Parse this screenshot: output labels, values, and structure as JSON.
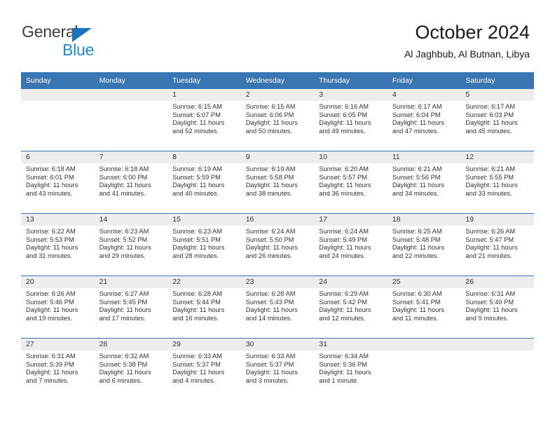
{
  "brand": {
    "name_part1": "General",
    "name_part2": "Blue",
    "triangle_color": "#1574bd",
    "blue_color": "#1e8ad6"
  },
  "header": {
    "title": "October 2024",
    "subtitle": "Al Jaghbub, Al Butnan, Libya"
  },
  "theme": {
    "header_blue": "#3b76b4",
    "daynum_band": "#ededed",
    "text": "#333333"
  },
  "weekdays": [
    "Sunday",
    "Monday",
    "Tuesday",
    "Wednesday",
    "Thursday",
    "Friday",
    "Saturday"
  ],
  "weeks": [
    [
      {
        "day": "",
        "sunrise": "",
        "sunset": "",
        "daylight_l1": "",
        "daylight_l2": ""
      },
      {
        "day": "",
        "sunrise": "",
        "sunset": "",
        "daylight_l1": "",
        "daylight_l2": ""
      },
      {
        "day": "1",
        "sunrise": "Sunrise: 6:15 AM",
        "sunset": "Sunset: 6:07 PM",
        "daylight_l1": "Daylight: 11 hours",
        "daylight_l2": "and 52 minutes."
      },
      {
        "day": "2",
        "sunrise": "Sunrise: 6:15 AM",
        "sunset": "Sunset: 6:06 PM",
        "daylight_l1": "Daylight: 11 hours",
        "daylight_l2": "and 50 minutes."
      },
      {
        "day": "3",
        "sunrise": "Sunrise: 6:16 AM",
        "sunset": "Sunset: 6:05 PM",
        "daylight_l1": "Daylight: 11 hours",
        "daylight_l2": "and 49 minutes."
      },
      {
        "day": "4",
        "sunrise": "Sunrise: 6:17 AM",
        "sunset": "Sunset: 6:04 PM",
        "daylight_l1": "Daylight: 11 hours",
        "daylight_l2": "and 47 minutes."
      },
      {
        "day": "5",
        "sunrise": "Sunrise: 6:17 AM",
        "sunset": "Sunset: 6:03 PM",
        "daylight_l1": "Daylight: 11 hours",
        "daylight_l2": "and 45 minutes."
      }
    ],
    [
      {
        "day": "6",
        "sunrise": "Sunrise: 6:18 AM",
        "sunset": "Sunset: 6:01 PM",
        "daylight_l1": "Daylight: 11 hours",
        "daylight_l2": "and 43 minutes."
      },
      {
        "day": "7",
        "sunrise": "Sunrise: 6:18 AM",
        "sunset": "Sunset: 6:00 PM",
        "daylight_l1": "Daylight: 11 hours",
        "daylight_l2": "and 41 minutes."
      },
      {
        "day": "8",
        "sunrise": "Sunrise: 6:19 AM",
        "sunset": "Sunset: 5:59 PM",
        "daylight_l1": "Daylight: 11 hours",
        "daylight_l2": "and 40 minutes."
      },
      {
        "day": "9",
        "sunrise": "Sunrise: 6:19 AM",
        "sunset": "Sunset: 5:58 PM",
        "daylight_l1": "Daylight: 11 hours",
        "daylight_l2": "and 38 minutes."
      },
      {
        "day": "10",
        "sunrise": "Sunrise: 6:20 AM",
        "sunset": "Sunset: 5:57 PM",
        "daylight_l1": "Daylight: 11 hours",
        "daylight_l2": "and 36 minutes."
      },
      {
        "day": "11",
        "sunrise": "Sunrise: 6:21 AM",
        "sunset": "Sunset: 5:56 PM",
        "daylight_l1": "Daylight: 11 hours",
        "daylight_l2": "and 34 minutes."
      },
      {
        "day": "12",
        "sunrise": "Sunrise: 6:21 AM",
        "sunset": "Sunset: 5:55 PM",
        "daylight_l1": "Daylight: 11 hours",
        "daylight_l2": "and 33 minutes."
      }
    ],
    [
      {
        "day": "13",
        "sunrise": "Sunrise: 6:22 AM",
        "sunset": "Sunset: 5:53 PM",
        "daylight_l1": "Daylight: 11 hours",
        "daylight_l2": "and 31 minutes."
      },
      {
        "day": "14",
        "sunrise": "Sunrise: 6:23 AM",
        "sunset": "Sunset: 5:52 PM",
        "daylight_l1": "Daylight: 11 hours",
        "daylight_l2": "and 29 minutes."
      },
      {
        "day": "15",
        "sunrise": "Sunrise: 6:23 AM",
        "sunset": "Sunset: 5:51 PM",
        "daylight_l1": "Daylight: 11 hours",
        "daylight_l2": "and 28 minutes."
      },
      {
        "day": "16",
        "sunrise": "Sunrise: 6:24 AM",
        "sunset": "Sunset: 5:50 PM",
        "daylight_l1": "Daylight: 11 hours",
        "daylight_l2": "and 26 minutes."
      },
      {
        "day": "17",
        "sunrise": "Sunrise: 6:24 AM",
        "sunset": "Sunset: 5:49 PM",
        "daylight_l1": "Daylight: 11 hours",
        "daylight_l2": "and 24 minutes."
      },
      {
        "day": "18",
        "sunrise": "Sunrise: 6:25 AM",
        "sunset": "Sunset: 5:48 PM",
        "daylight_l1": "Daylight: 11 hours",
        "daylight_l2": "and 22 minutes."
      },
      {
        "day": "19",
        "sunrise": "Sunrise: 6:26 AM",
        "sunset": "Sunset: 5:47 PM",
        "daylight_l1": "Daylight: 11 hours",
        "daylight_l2": "and 21 minutes."
      }
    ],
    [
      {
        "day": "20",
        "sunrise": "Sunrise: 6:26 AM",
        "sunset": "Sunset: 5:46 PM",
        "daylight_l1": "Daylight: 11 hours",
        "daylight_l2": "and 19 minutes."
      },
      {
        "day": "21",
        "sunrise": "Sunrise: 6:27 AM",
        "sunset": "Sunset: 5:45 PM",
        "daylight_l1": "Daylight: 11 hours",
        "daylight_l2": "and 17 minutes."
      },
      {
        "day": "22",
        "sunrise": "Sunrise: 6:28 AM",
        "sunset": "Sunset: 5:44 PM",
        "daylight_l1": "Daylight: 11 hours",
        "daylight_l2": "and 16 minutes."
      },
      {
        "day": "23",
        "sunrise": "Sunrise: 6:28 AM",
        "sunset": "Sunset: 5:43 PM",
        "daylight_l1": "Daylight: 11 hours",
        "daylight_l2": "and 14 minutes."
      },
      {
        "day": "24",
        "sunrise": "Sunrise: 6:29 AM",
        "sunset": "Sunset: 5:42 PM",
        "daylight_l1": "Daylight: 11 hours",
        "daylight_l2": "and 12 minutes."
      },
      {
        "day": "25",
        "sunrise": "Sunrise: 6:30 AM",
        "sunset": "Sunset: 5:41 PM",
        "daylight_l1": "Daylight: 11 hours",
        "daylight_l2": "and 11 minutes."
      },
      {
        "day": "26",
        "sunrise": "Sunrise: 6:31 AM",
        "sunset": "Sunset: 5:40 PM",
        "daylight_l1": "Daylight: 11 hours",
        "daylight_l2": "and 9 minutes."
      }
    ],
    [
      {
        "day": "27",
        "sunrise": "Sunrise: 6:31 AM",
        "sunset": "Sunset: 5:39 PM",
        "daylight_l1": "Daylight: 11 hours",
        "daylight_l2": "and 7 minutes."
      },
      {
        "day": "28",
        "sunrise": "Sunrise: 6:32 AM",
        "sunset": "Sunset: 5:38 PM",
        "daylight_l1": "Daylight: 11 hours",
        "daylight_l2": "and 6 minutes."
      },
      {
        "day": "29",
        "sunrise": "Sunrise: 6:33 AM",
        "sunset": "Sunset: 5:37 PM",
        "daylight_l1": "Daylight: 11 hours",
        "daylight_l2": "and 4 minutes."
      },
      {
        "day": "30",
        "sunrise": "Sunrise: 6:33 AM",
        "sunset": "Sunset: 5:37 PM",
        "daylight_l1": "Daylight: 11 hours",
        "daylight_l2": "and 3 minutes."
      },
      {
        "day": "31",
        "sunrise": "Sunrise: 6:34 AM",
        "sunset": "Sunset: 5:36 PM",
        "daylight_l1": "Daylight: 11 hours",
        "daylight_l2": "and 1 minute."
      },
      {
        "day": "",
        "sunrise": "",
        "sunset": "",
        "daylight_l1": "",
        "daylight_l2": ""
      },
      {
        "day": "",
        "sunrise": "",
        "sunset": "",
        "daylight_l1": "",
        "daylight_l2": ""
      }
    ]
  ]
}
